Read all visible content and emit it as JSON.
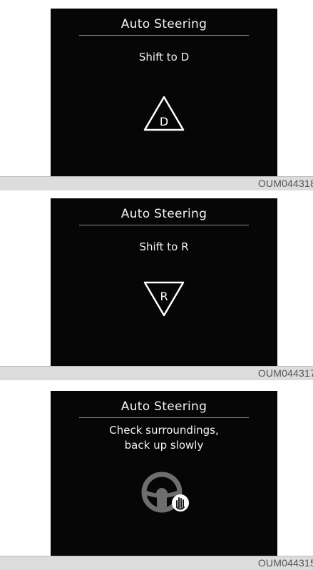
{
  "panels": [
    {
      "title": "Auto Steering",
      "message_lines": [
        "Shift to D"
      ],
      "icon": "warning-triangle-icon",
      "icon_letter": "D",
      "code": "OUM044318"
    },
    {
      "title": "Auto Steering",
      "message_lines": [
        "Shift to R"
      ],
      "icon": "inverted-triangle-icon",
      "icon_letter": "R",
      "code": "OUM044317"
    },
    {
      "title": "Auto Steering",
      "message_lines": [
        "Check surroundings,",
        "back up slowly"
      ],
      "icon": "steering-wheel-hand-icon",
      "code": "OUM044315"
    }
  ],
  "colors": {
    "screen_bg": "#060606",
    "text": "#f2f2f2",
    "divider": "#8a8a8a",
    "footer_bg": "#dcdcdc",
    "icon_gray": "#6e6e6e"
  }
}
